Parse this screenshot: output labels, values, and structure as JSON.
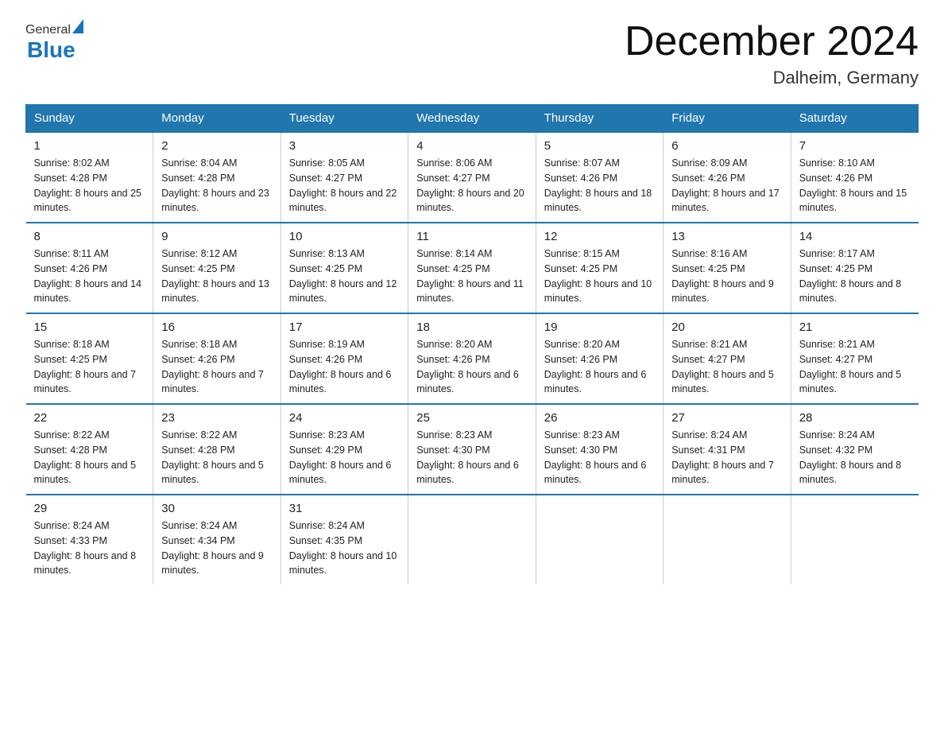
{
  "header": {
    "logo_general": "General",
    "logo_blue": "Blue",
    "month_title": "December 2024",
    "location": "Dalheim, Germany"
  },
  "weekdays": [
    "Sunday",
    "Monday",
    "Tuesday",
    "Wednesday",
    "Thursday",
    "Friday",
    "Saturday"
  ],
  "weeks": [
    [
      {
        "day": "1",
        "sunrise": "8:02 AM",
        "sunset": "4:28 PM",
        "daylight": "8 hours and 25 minutes."
      },
      {
        "day": "2",
        "sunrise": "8:04 AM",
        "sunset": "4:28 PM",
        "daylight": "8 hours and 23 minutes."
      },
      {
        "day": "3",
        "sunrise": "8:05 AM",
        "sunset": "4:27 PM",
        "daylight": "8 hours and 22 minutes."
      },
      {
        "day": "4",
        "sunrise": "8:06 AM",
        "sunset": "4:27 PM",
        "daylight": "8 hours and 20 minutes."
      },
      {
        "day": "5",
        "sunrise": "8:07 AM",
        "sunset": "4:26 PM",
        "daylight": "8 hours and 18 minutes."
      },
      {
        "day": "6",
        "sunrise": "8:09 AM",
        "sunset": "4:26 PM",
        "daylight": "8 hours and 17 minutes."
      },
      {
        "day": "7",
        "sunrise": "8:10 AM",
        "sunset": "4:26 PM",
        "daylight": "8 hours and 15 minutes."
      }
    ],
    [
      {
        "day": "8",
        "sunrise": "8:11 AM",
        "sunset": "4:26 PM",
        "daylight": "8 hours and 14 minutes."
      },
      {
        "day": "9",
        "sunrise": "8:12 AM",
        "sunset": "4:25 PM",
        "daylight": "8 hours and 13 minutes."
      },
      {
        "day": "10",
        "sunrise": "8:13 AM",
        "sunset": "4:25 PM",
        "daylight": "8 hours and 12 minutes."
      },
      {
        "day": "11",
        "sunrise": "8:14 AM",
        "sunset": "4:25 PM",
        "daylight": "8 hours and 11 minutes."
      },
      {
        "day": "12",
        "sunrise": "8:15 AM",
        "sunset": "4:25 PM",
        "daylight": "8 hours and 10 minutes."
      },
      {
        "day": "13",
        "sunrise": "8:16 AM",
        "sunset": "4:25 PM",
        "daylight": "8 hours and 9 minutes."
      },
      {
        "day": "14",
        "sunrise": "8:17 AM",
        "sunset": "4:25 PM",
        "daylight": "8 hours and 8 minutes."
      }
    ],
    [
      {
        "day": "15",
        "sunrise": "8:18 AM",
        "sunset": "4:25 PM",
        "daylight": "8 hours and 7 minutes."
      },
      {
        "day": "16",
        "sunrise": "8:18 AM",
        "sunset": "4:26 PM",
        "daylight": "8 hours and 7 minutes."
      },
      {
        "day": "17",
        "sunrise": "8:19 AM",
        "sunset": "4:26 PM",
        "daylight": "8 hours and 6 minutes."
      },
      {
        "day": "18",
        "sunrise": "8:20 AM",
        "sunset": "4:26 PM",
        "daylight": "8 hours and 6 minutes."
      },
      {
        "day": "19",
        "sunrise": "8:20 AM",
        "sunset": "4:26 PM",
        "daylight": "8 hours and 6 minutes."
      },
      {
        "day": "20",
        "sunrise": "8:21 AM",
        "sunset": "4:27 PM",
        "daylight": "8 hours and 5 minutes."
      },
      {
        "day": "21",
        "sunrise": "8:21 AM",
        "sunset": "4:27 PM",
        "daylight": "8 hours and 5 minutes."
      }
    ],
    [
      {
        "day": "22",
        "sunrise": "8:22 AM",
        "sunset": "4:28 PM",
        "daylight": "8 hours and 5 minutes."
      },
      {
        "day": "23",
        "sunrise": "8:22 AM",
        "sunset": "4:28 PM",
        "daylight": "8 hours and 5 minutes."
      },
      {
        "day": "24",
        "sunrise": "8:23 AM",
        "sunset": "4:29 PM",
        "daylight": "8 hours and 6 minutes."
      },
      {
        "day": "25",
        "sunrise": "8:23 AM",
        "sunset": "4:30 PM",
        "daylight": "8 hours and 6 minutes."
      },
      {
        "day": "26",
        "sunrise": "8:23 AM",
        "sunset": "4:30 PM",
        "daylight": "8 hours and 6 minutes."
      },
      {
        "day": "27",
        "sunrise": "8:24 AM",
        "sunset": "4:31 PM",
        "daylight": "8 hours and 7 minutes."
      },
      {
        "day": "28",
        "sunrise": "8:24 AM",
        "sunset": "4:32 PM",
        "daylight": "8 hours and 8 minutes."
      }
    ],
    [
      {
        "day": "29",
        "sunrise": "8:24 AM",
        "sunset": "4:33 PM",
        "daylight": "8 hours and 8 minutes."
      },
      {
        "day": "30",
        "sunrise": "8:24 AM",
        "sunset": "4:34 PM",
        "daylight": "8 hours and 9 minutes."
      },
      {
        "day": "31",
        "sunrise": "8:24 AM",
        "sunset": "4:35 PM",
        "daylight": "8 hours and 10 minutes."
      },
      null,
      null,
      null,
      null
    ]
  ]
}
